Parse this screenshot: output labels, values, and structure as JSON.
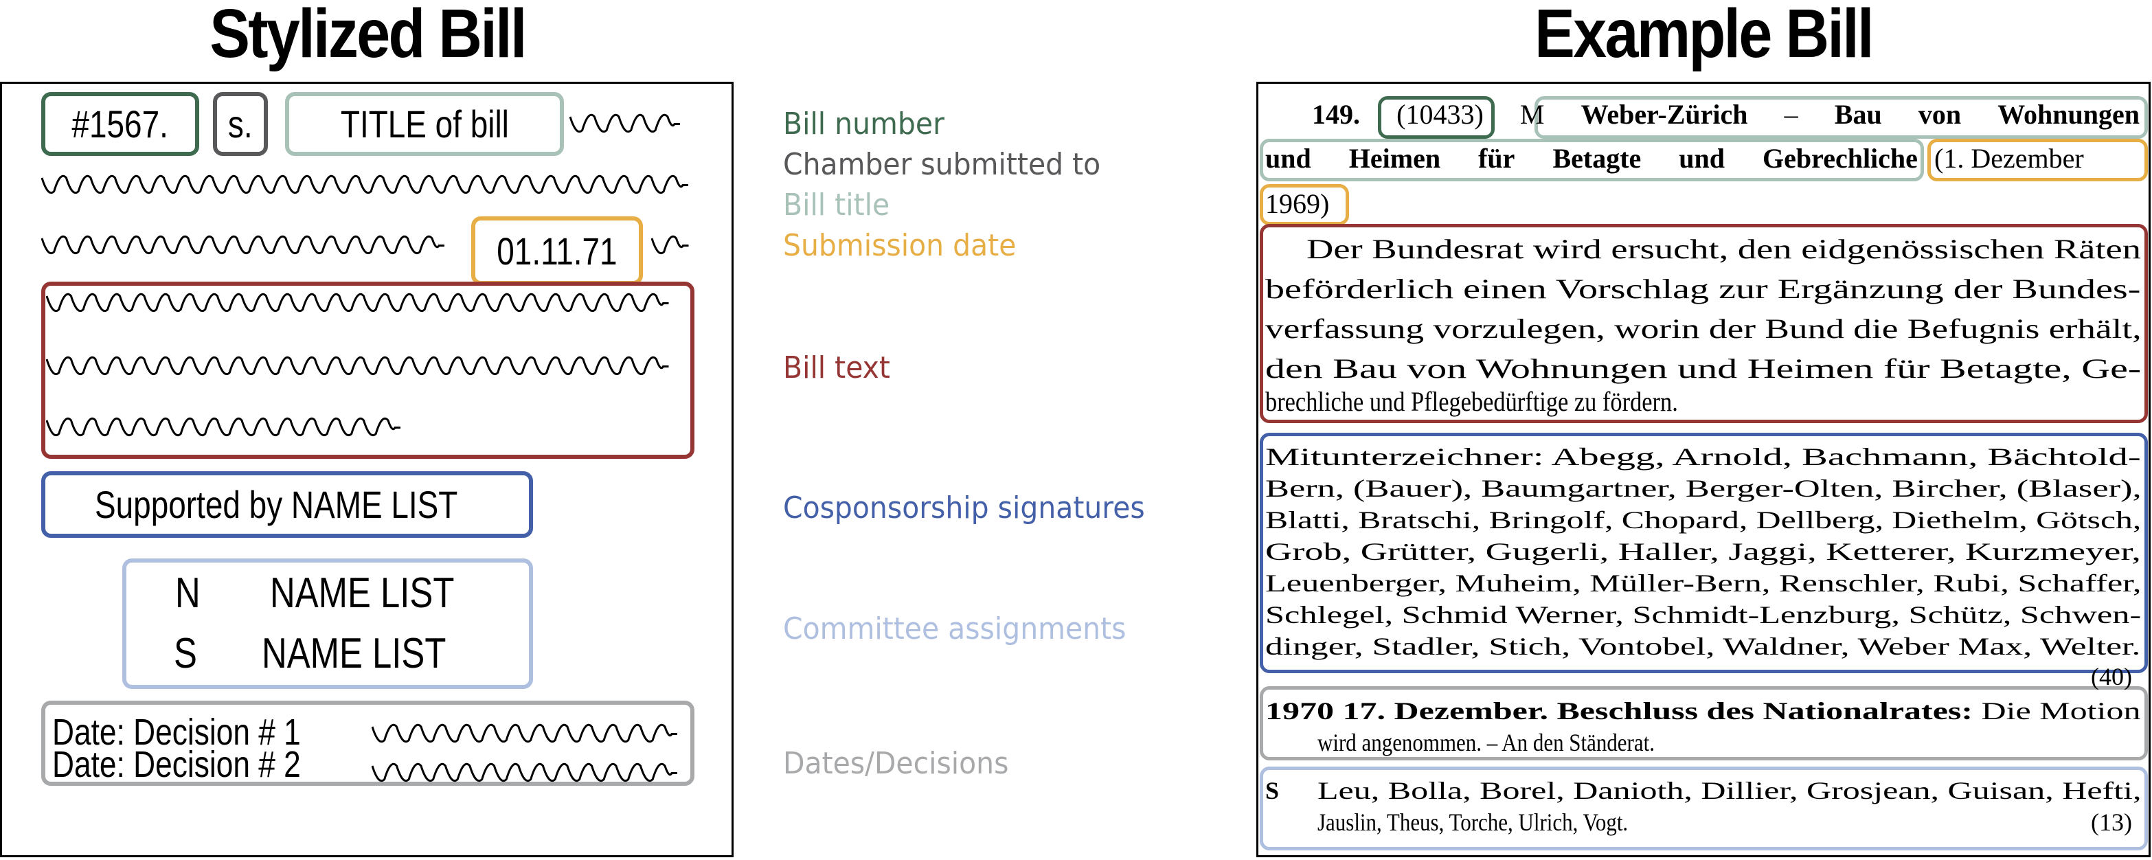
{
  "colors": {
    "bill_number": "#3e6b50",
    "chamber": "#58585a",
    "bill_title": "#a8c2b8",
    "submission_date": "#e8ae46",
    "bill_text": "#963634",
    "cosponsorship": "#4460a8",
    "committee": "#aebfe0",
    "decisions": "#a8a9ab"
  },
  "headings": {
    "left": "Stylized Bill",
    "right": "Example Bill"
  },
  "stylized": {
    "bill_number": "#1567.",
    "chamber": "s.",
    "title": "TITLE of bill",
    "date": "01.11.71",
    "supported_by": "Supported by NAME LIST",
    "committee_rows": [
      {
        "chamber": "N",
        "names": "NAME LIST"
      },
      {
        "chamber": "S",
        "names": "NAME LIST"
      }
    ],
    "decisions": [
      "Date: Decision # 1",
      "Date: Decision # 2"
    ]
  },
  "legend": [
    {
      "key": "bill_number",
      "label": "Bill number"
    },
    {
      "key": "chamber",
      "label": "Chamber submitted to"
    },
    {
      "key": "bill_title",
      "label": "Bill title"
    },
    {
      "key": "submission_date",
      "label": "Submission date"
    },
    {
      "key": "bill_text",
      "label": "Bill text"
    },
    {
      "key": "cosponsorship",
      "label": "Cosponsorship signatures"
    },
    {
      "key": "committee",
      "label": "Committee assignments"
    },
    {
      "key": "decisions",
      "label": "Dates/Decisions"
    }
  ],
  "example": {
    "entry_number": "149.",
    "bill_number": "(10433)",
    "chamber": "M",
    "title_line1_author": "Weber-Zürich",
    "title_line1_dash": "–",
    "title_line1_words": [
      "Bau",
      "von",
      "Wohnungen"
    ],
    "title_line2_words": [
      "und",
      "Heimen",
      "für",
      "Betagte",
      "und",
      "Gebrechliche"
    ],
    "date_line1": "(1. Dezember",
    "date_line2": "1969)",
    "bill_text_lines": [
      "Der Bundesrat wird ersucht, den eidgenössischen Räten",
      "beförderlich einen Vorschlag zur Ergänzung der Bundes-",
      "verfassung vorzulegen, worin der Bund die Befugnis erhält,",
      "den Bau von Wohnungen und Heimen für Betagte, Ge-",
      "brechliche und Pflegebedürftige zu fördern."
    ],
    "cosponsor_lines": [
      "Mitunterzeichner: Abegg, Arnold, Bachmann, Bächtold-",
      "Bern, (Bauer), Baumgartner, Berger-Olten, Bircher, (Blaser),",
      "Blatti, Bratschi, Bringolf, Chopard, Dellberg, Diethelm, Götsch,",
      "Grob, Grütter, Gugerli, Haller, Jaggi, Ketterer, Kurzmeyer,",
      "Leuenberger, Muheim, Müller-Bern, Renschler, Rubi, Schaffer,",
      "Schlegel, Schmid Werner, Schmidt-Lenzburg, Schütz, Schwen-",
      "dinger, Stadler, Stich, Vontobel, Waldner, Weber Max, Welter."
    ],
    "cosponsor_count": "(40)",
    "decision_year": "1970",
    "decision_bold": "17. Dezember. Beschluss des Nationalrates:",
    "decision_rest_line1": "Die Motion",
    "decision_line2": "wird angenommen. – An den Ständerat.",
    "committee_chamber": "S",
    "committee_line1": "Leu, Bolla, Borel, Danioth, Dillier, Grosjean, Guisan, Hefti,",
    "committee_line2": "Jauslin, Theus, Torche, Ulrich, Vogt.",
    "committee_count": "(13)"
  }
}
